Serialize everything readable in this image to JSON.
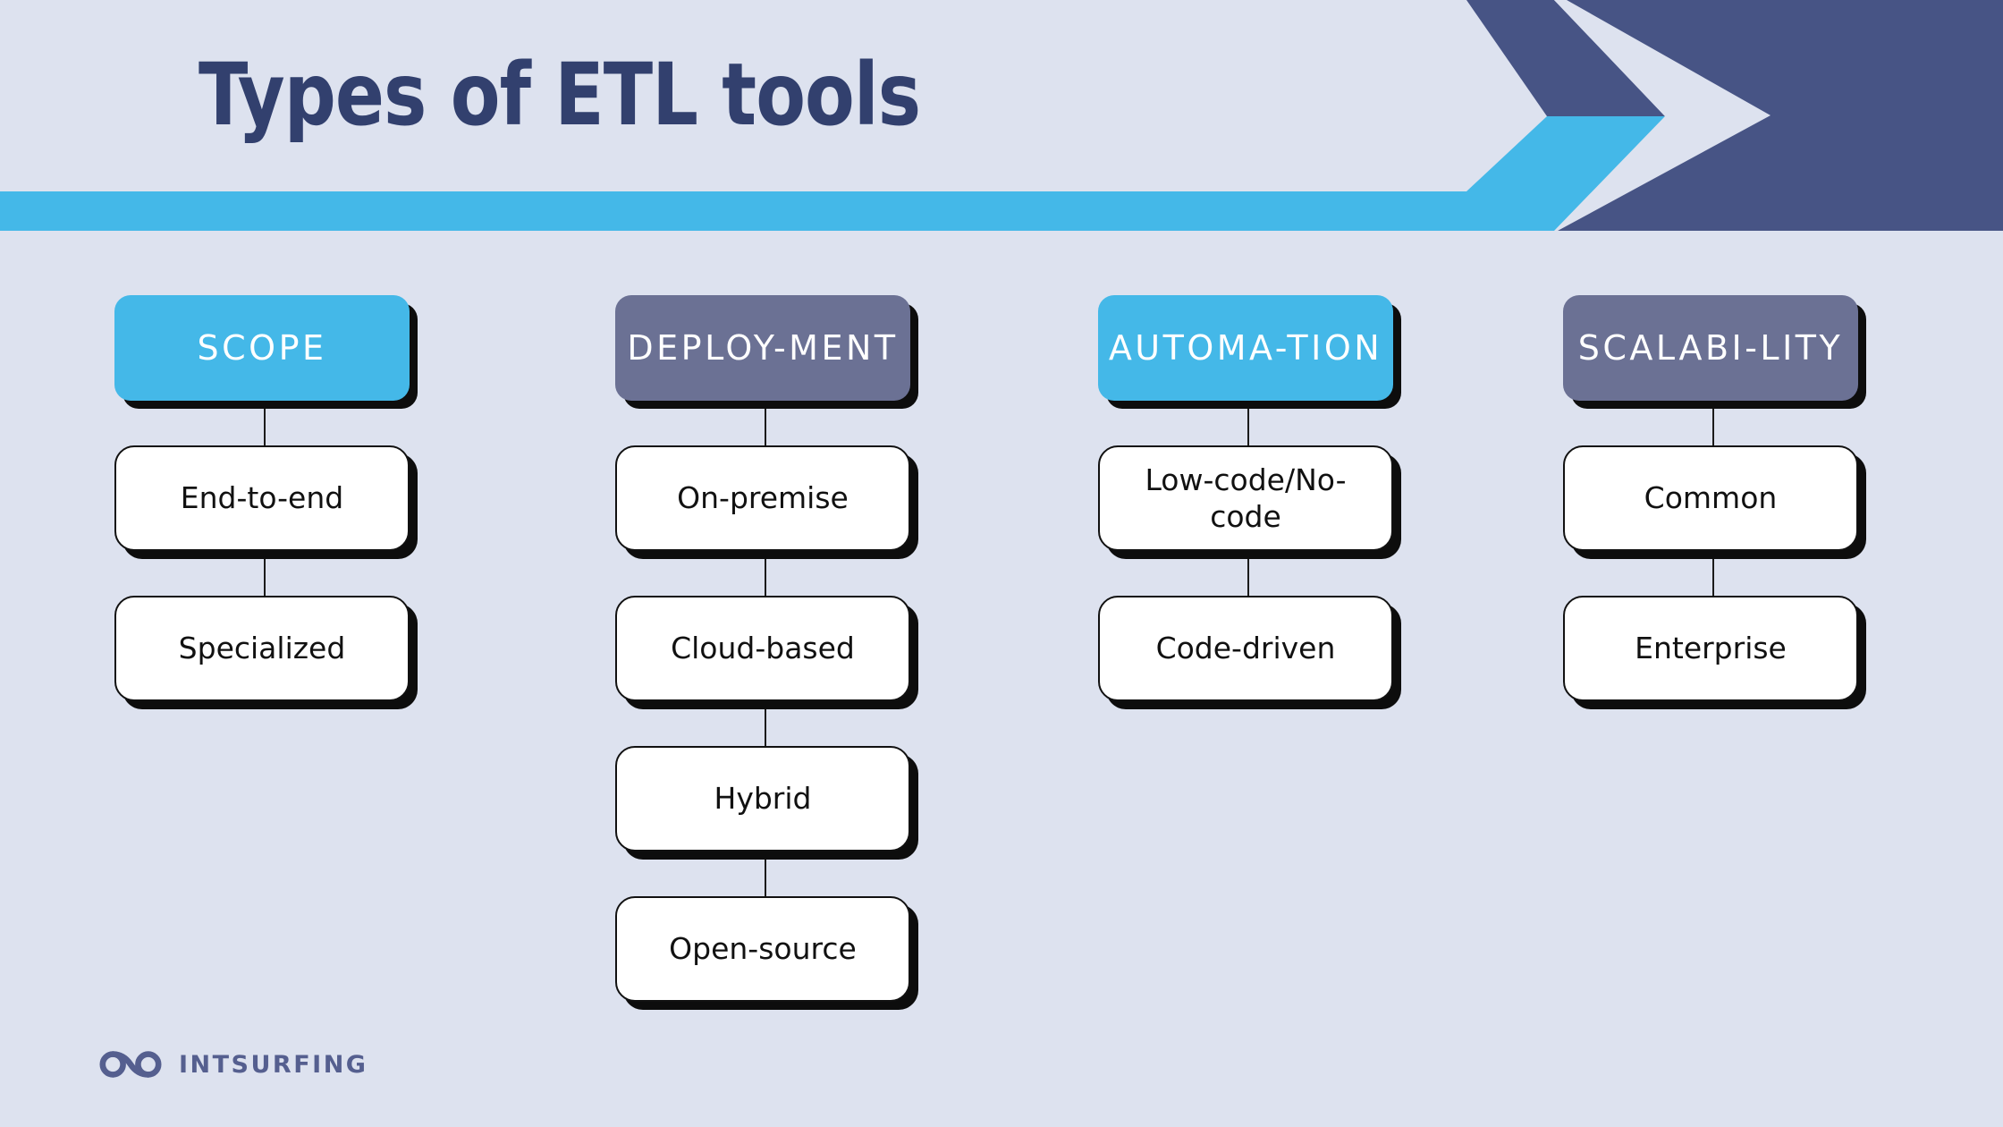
{
  "slide": {
    "title": "Types of ETL tools",
    "background_color": "#dde2ef"
  },
  "theme": {
    "accent_blue": "#44b8e8",
    "accent_slate": "#6b7194",
    "navy": "#475485",
    "title_color": "#32406e",
    "shadow": "#0d0d0d",
    "box_fill": "#ffffff",
    "box_border": "#111111"
  },
  "columns": [
    {
      "header": "SCOPE",
      "header_style": "blue",
      "items": [
        "End-to-end",
        "Specialized"
      ]
    },
    {
      "header": "DEPLOY-MENT",
      "header_style": "slate",
      "items": [
        "On-premise",
        "Cloud-based",
        "Hybrid",
        "Open-source"
      ]
    },
    {
      "header": "AUTOMA-TION",
      "header_style": "blue",
      "items": [
        "Low-code/No-code",
        "Code-driven"
      ]
    },
    {
      "header": "SCALABI-LITY",
      "header_style": "slate",
      "items": [
        "Common",
        "Enterprise"
      ]
    }
  ],
  "logo": {
    "name": "INTSURFING",
    "color": "#555f8f"
  }
}
